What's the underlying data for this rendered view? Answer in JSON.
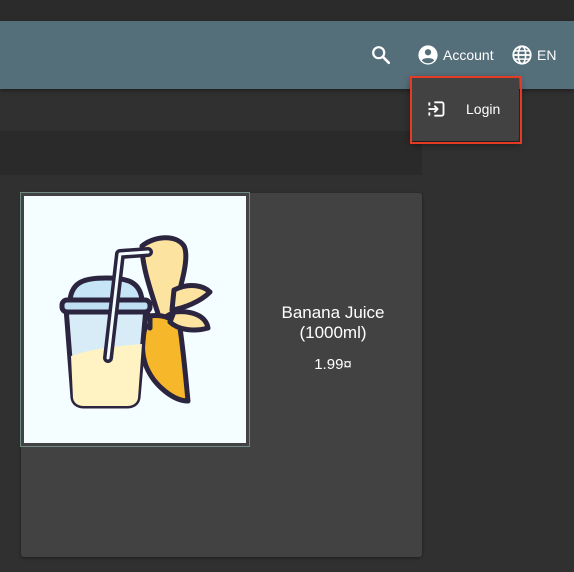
{
  "header": {
    "search_icon": "search-icon",
    "account_label": "Account",
    "account_icon": "account-circle-icon",
    "language_label": "EN",
    "language_icon": "globe-icon",
    "toolbar_color": "#546e7a"
  },
  "account_menu": {
    "items": [
      {
        "label": "Login",
        "icon": "login-icon"
      }
    ],
    "highlight_color": "#e53a23"
  },
  "product": {
    "name_line1": "Banana Juice",
    "name_line2": "(1000ml)",
    "price": "1.99¤",
    "image_icon": "banana-juice-illustration"
  }
}
